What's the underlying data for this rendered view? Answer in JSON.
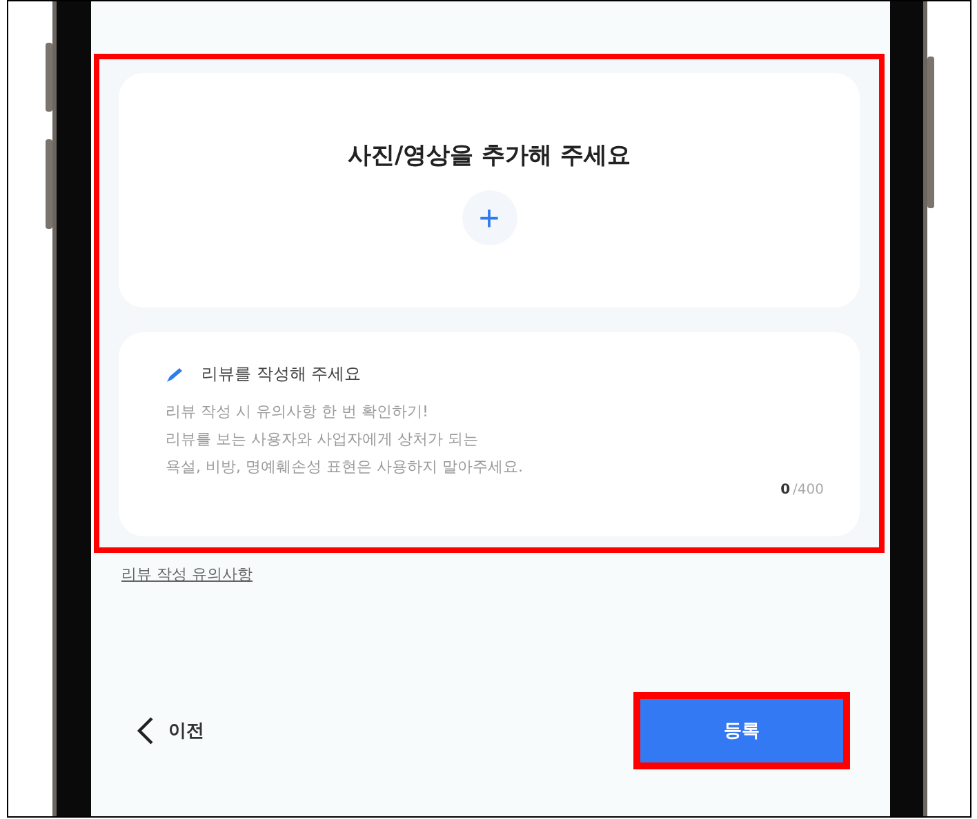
{
  "media_card": {
    "title": "사진/영상을 추가해 주세요",
    "add_symbol": "+"
  },
  "review_card": {
    "heading": "리뷰를 작성해 주세요",
    "placeholder_lines": [
      "리뷰 작성 시 유의사항 한 번 확인하기!",
      "리뷰를 보는 사용자와 사업자에게 상처가 되는",
      "욕설, 비방, 명예훼손성 표현은 사용하지 말아주세요."
    ],
    "count": "0",
    "limit": "/400"
  },
  "guide_link": "리뷰 작성 유의사항",
  "footer": {
    "back_label": "이전",
    "submit_label": "등록"
  }
}
